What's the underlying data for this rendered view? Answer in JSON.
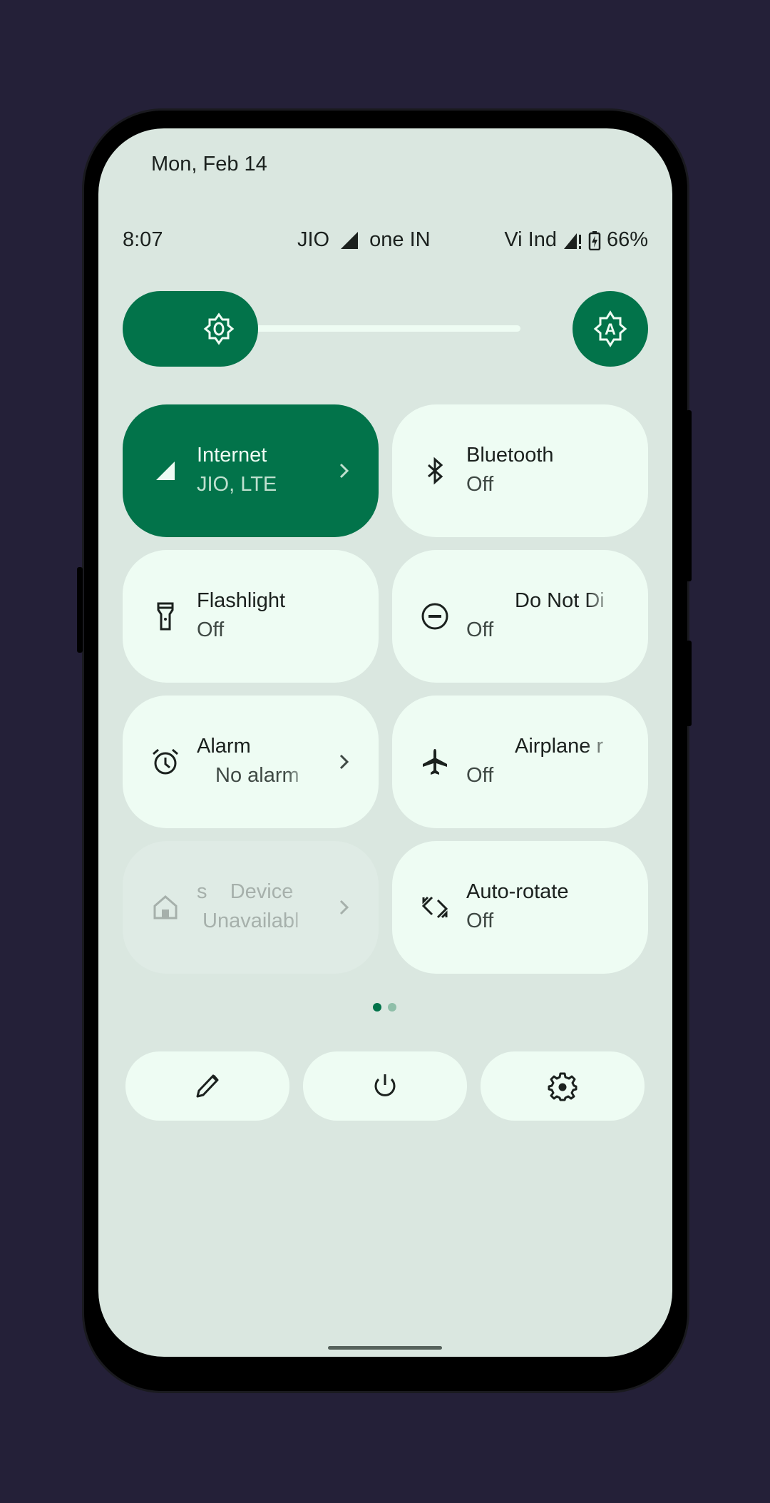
{
  "header": {
    "date": "Mon, Feb 14"
  },
  "status_bar": {
    "time": "8:07",
    "carrier_1": "JIO",
    "carrier_2": "one IN",
    "carrier_3": "Vi Ind",
    "battery_percent": "66%",
    "icons": [
      "signal-full-icon",
      "signal-no-data-icon",
      "battery-charging-icon"
    ]
  },
  "brightness": {
    "level_fraction": 0.26,
    "icon": "brightness-icon",
    "auto_icon": "auto-brightness-icon"
  },
  "tiles": [
    {
      "label": "Internet",
      "sub": "JIO, LTE",
      "state": "active",
      "icon": "cellular-signal-icon",
      "has_chevron": true
    },
    {
      "label": "Bluetooth",
      "sub": "Off",
      "state": "off",
      "icon": "bluetooth-icon",
      "has_chevron": false
    },
    {
      "label": "Flashlight",
      "sub": "Off",
      "state": "off",
      "icon": "flashlight-icon",
      "has_chevron": false
    },
    {
      "label": "Do Not Di",
      "sub": "Off",
      "state": "off",
      "icon": "do-not-disturb-icon",
      "has_chevron": false
    },
    {
      "label": "Alarm",
      "sub": "No alarm",
      "state": "off",
      "icon": "alarm-icon",
      "has_chevron": true
    },
    {
      "label": "Airplane r",
      "sub": "Off",
      "state": "off",
      "icon": "airplane-icon",
      "has_chevron": false
    },
    {
      "label": "s    Device",
      "sub": "Unavailabl",
      "state": "unavailable",
      "icon": "home-icon",
      "has_chevron": true
    },
    {
      "label": "Auto-rotate",
      "sub": "Off",
      "state": "off",
      "icon": "auto-rotate-icon",
      "has_chevron": false
    }
  ],
  "pager": {
    "pages": 2,
    "current": 1
  },
  "bottom_actions": [
    {
      "name": "edit",
      "icon": "pencil-icon"
    },
    {
      "name": "power",
      "icon": "power-icon"
    },
    {
      "name": "settings",
      "icon": "gear-icon"
    }
  ],
  "colors": {
    "accent": "#02734a",
    "tile_bg": "#eefcf3",
    "panel_bg": "#dae7e0",
    "backdrop": "#242038",
    "dot_inactive": "#8fbfa9"
  }
}
